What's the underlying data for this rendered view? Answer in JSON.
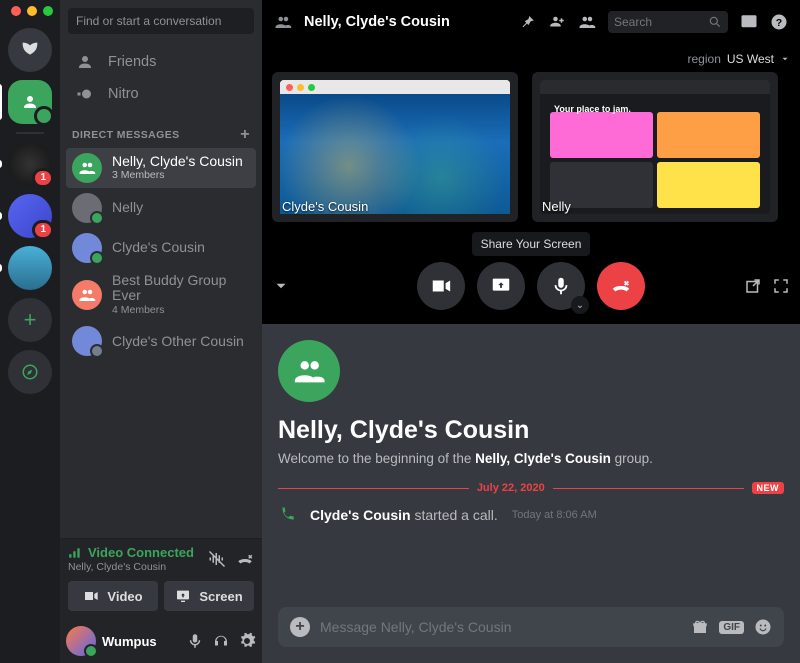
{
  "sidebar": {
    "search_placeholder": "Find or start a conversation",
    "nav": {
      "friends": "Friends",
      "nitro": "Nitro"
    },
    "dm_header": "DIRECT MESSAGES",
    "items": [
      {
        "name": "Nelly, Clyde's Cousin",
        "sub": "3 Members"
      },
      {
        "name": "Nelly"
      },
      {
        "name": "Clyde's Cousin"
      },
      {
        "name": "Best Buddy Group Ever",
        "sub": "4 Members"
      },
      {
        "name": "Clyde's Other Cousin"
      }
    ]
  },
  "voice": {
    "status": "Video Connected",
    "channel": "Nelly, Clyde's Cousin",
    "video_btn": "Video",
    "screen_btn": "Screen"
  },
  "user": {
    "name": "Wumpus"
  },
  "topbar": {
    "title": "Nelly, Clyde's Cousin",
    "search_placeholder": "Search",
    "region_label": "region",
    "region_value": "US West"
  },
  "call": {
    "streams": [
      {
        "name": "Clyde's Cousin"
      },
      {
        "name": "Nelly",
        "hint": "Your place to jam."
      }
    ],
    "tooltip": "Share Your Screen"
  },
  "chat": {
    "title": "Nelly, Clyde's Cousin",
    "welcome_prefix": "Welcome to the beginning of the ",
    "welcome_group": "Nelly, Clyde's Cousin",
    "welcome_suffix": " group.",
    "date": "July 22, 2020",
    "new_badge": "NEW",
    "msg_author": "Clyde's Cousin",
    "msg_action": " started a call.",
    "msg_time": "Today at 8:06 AM",
    "composer_placeholder": "Message Nelly, Clyde's Cousin",
    "gif_label": "GIF"
  }
}
